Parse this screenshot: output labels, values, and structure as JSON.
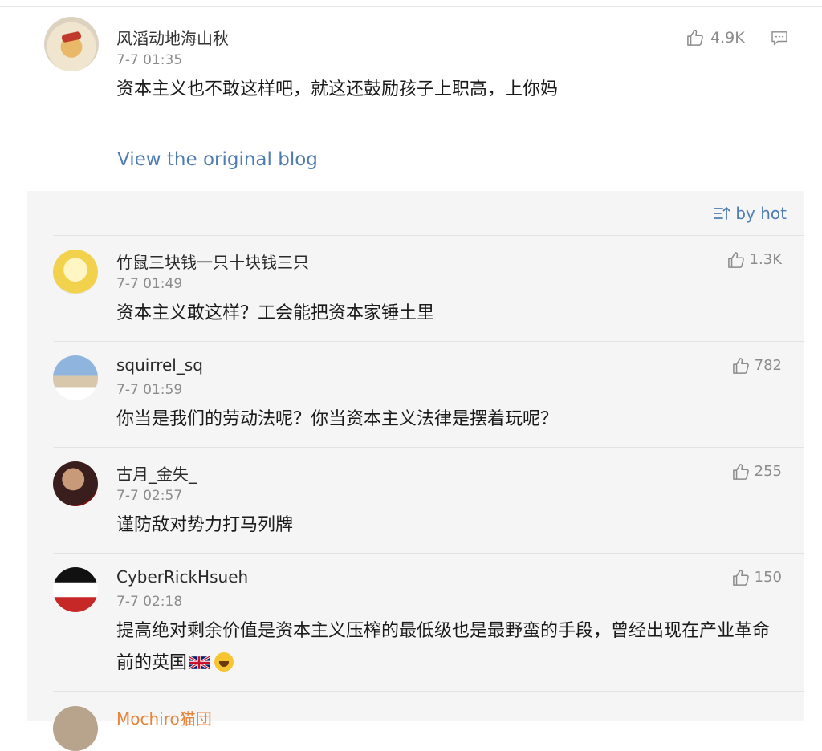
{
  "main_comment": {
    "username": "风滔动地海山秋",
    "time": "7-7 01:35",
    "likes": "4.9K",
    "text": "资本主义也不敢这样吧，就这还鼓励孩子上职高，上你妈",
    "view_original": "View the original blog"
  },
  "sort": {
    "label": "by hot"
  },
  "replies": [
    {
      "username": "竹鼠三块钱一只十块钱三只",
      "time": "7-7 01:49",
      "likes": "1.3K",
      "text": "资本主义敢这样？工会能把资本家锤土里"
    },
    {
      "username": "squirrel_sq",
      "time": "7-7 01:59",
      "likes": "782",
      "text": "你当是我们的劳动法呢？你当资本主义法律是摆着玩呢？"
    },
    {
      "username": "古月_金失_",
      "time": "7-7 02:57",
      "likes": "255",
      "text": "谨防敌对势力打马列牌"
    },
    {
      "username": "CyberRickHsueh",
      "time": "7-7 02:18",
      "likes": "150",
      "text": "提高绝对剩余价值是资本主义压榨的最低级也是最野蛮的手段，曾经出现在产业革命前的英国"
    }
  ],
  "partial_reply": {
    "username": "Mochiro猫団"
  },
  "colors": {
    "link": "#4f7db3",
    "panel_bg": "#f5f5f5",
    "meta": "#8c8c8c"
  }
}
